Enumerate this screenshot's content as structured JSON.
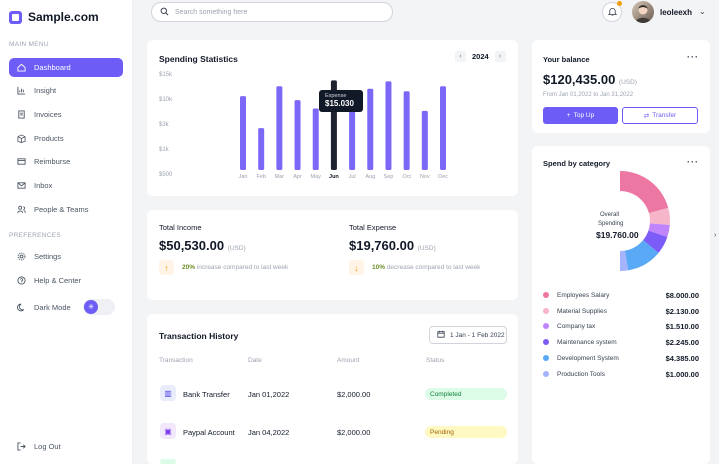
{
  "app": {
    "name": "Sample.com"
  },
  "sidebar": {
    "main_menu_label": "MAIN MENU",
    "preferences_label": "PREFERENCES",
    "items": [
      {
        "label": "Dashboard",
        "icon": "dashboard-icon",
        "active": true
      },
      {
        "label": "Insight",
        "icon": "chart-icon"
      },
      {
        "label": "Invoices",
        "icon": "invoice-icon"
      },
      {
        "label": "Products",
        "icon": "box-icon"
      },
      {
        "label": "Reimburse",
        "icon": "card-icon"
      },
      {
        "label": "Inbox",
        "icon": "mail-icon"
      },
      {
        "label": "People & Teams",
        "icon": "people-icon"
      }
    ],
    "preference_items": [
      {
        "label": "Settings",
        "icon": "gear-icon"
      },
      {
        "label": "Help & Center",
        "icon": "help-icon"
      },
      {
        "label": "Dark Mode",
        "icon": "moon-icon"
      }
    ],
    "logout_label": "Log Out"
  },
  "topbar": {
    "search_placeholder": "Search something here",
    "username": "leoleexh"
  },
  "spending": {
    "title": "Spending Statistics",
    "year": "2024",
    "tooltip_label": "Expense",
    "tooltip_value": "$15.030"
  },
  "chart_data": {
    "type": "bar",
    "title": "Spending Statistics",
    "categories": [
      "Jan",
      "Feb",
      "Mar",
      "Apr",
      "May",
      "Jun",
      "Jul",
      "Aug",
      "Sep",
      "Oct",
      "Nov",
      "Dec"
    ],
    "values": [
      15000,
      8500,
      17000,
      14200,
      12500,
      18200,
      14500,
      16500,
      18000,
      16000,
      12000,
      17000
    ],
    "highlight_index": 5,
    "y_ticks": [
      "$500",
      "$1k",
      "$3k",
      "$10k",
      "$15k"
    ],
    "ylim": [
      0,
      19500
    ],
    "colors": {
      "bar": "#7c68f7",
      "highlight": "#1f2330"
    }
  },
  "income": {
    "title": "Total Income",
    "amount": "$50,530.00",
    "unit": "(USD)",
    "trend_percent": "20%",
    "trend_text": " increase compared to last week"
  },
  "expense": {
    "title": "Total Expense",
    "amount": "$19,760.00",
    "unit": "(USD)",
    "trend_percent": "10%",
    "trend_text": " decrease compared to last week"
  },
  "transactions": {
    "title": "Transaction History",
    "date_filter": "1 Jan - 1 Feb 2022",
    "headers": [
      "Transaction",
      "Date",
      "Amount",
      "Status"
    ],
    "rows": [
      {
        "name": "Bank Transfer",
        "date": "Jan 01,2022",
        "amount": "$2,000.00",
        "status": "Completed",
        "icon": "bank-icon"
      },
      {
        "name": "Paypal Account",
        "date": "Jan 04,2022",
        "amount": "$2,000.00",
        "status": "Pending",
        "icon": "paypal-icon"
      }
    ],
    "status_colors": {
      "Completed": "#dcfce7",
      "Pending": "#fef9c3"
    }
  },
  "balance": {
    "title": "Your balance",
    "amount": "$120,435.00",
    "unit": "(USD)",
    "range": "From Jan 01,2022 to Jan 31,2022",
    "topup_label": "Top Up",
    "transfer_label": "Transfer"
  },
  "category": {
    "title": "Spend by category",
    "center_label_1": "Overall",
    "center_label_2": "Spending",
    "center_value": "$19.760.00",
    "items": [
      {
        "name": "Employees Salary",
        "value": "$8.000.00",
        "amount": 8000,
        "color": "#ec77a2"
      },
      {
        "name": "Material Supplies",
        "value": "$2.130.00",
        "amount": 2130,
        "color": "#f6b5c9"
      },
      {
        "name": "Company tax",
        "value": "$1.510.00",
        "amount": 1510,
        "color": "#c084fc"
      },
      {
        "name": "Maintenance system",
        "value": "$2.245.00",
        "amount": 2245,
        "color": "#7c5cf6"
      },
      {
        "name": "Development System",
        "value": "$4.385.00",
        "amount": 4385,
        "color": "#5aa9f6"
      },
      {
        "name": "Production Tools",
        "value": "$1.000.00",
        "amount": 1000,
        "color": "#a5b4fc"
      }
    ]
  }
}
